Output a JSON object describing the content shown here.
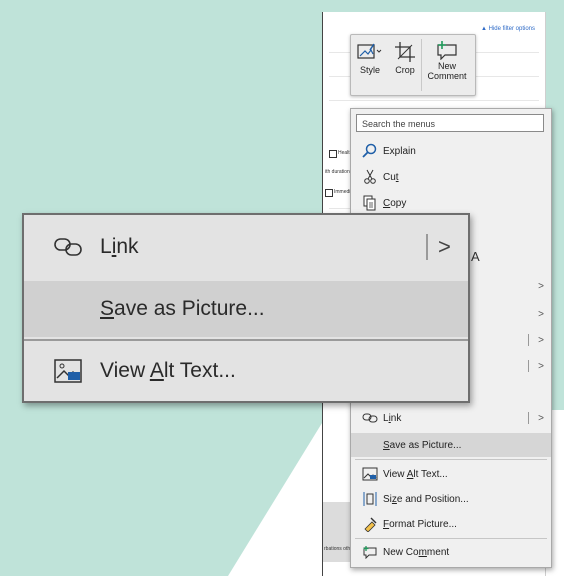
{
  "document": {
    "hide_filter_options": "▲ Hide filter options",
    "fragments": [
      "Health",
      "ith duration o",
      "Immedia",
      "rbations otherw"
    ]
  },
  "picture_toolbar": {
    "style_label": "Style",
    "crop_label": "Crop",
    "new_comment_line1": "New",
    "new_comment_line2": "Comment"
  },
  "context_menu": {
    "search_placeholder": "Search the menus",
    "explain": "Explain",
    "cut": {
      "pre": "Cu",
      "acc": "t",
      "post": ""
    },
    "copy": {
      "pre": "",
      "acc": "C",
      "post": "opy"
    },
    "link": {
      "pre": "L",
      "acc": "i",
      "post": "nk"
    },
    "save_as_picture": {
      "pre": "",
      "acc": "S",
      "post": "ave as Picture..."
    },
    "view_alt_text": {
      "pre": "View ",
      "acc": "A",
      "post": "lt Text..."
    },
    "size_and_position": {
      "pre": "Si",
      "acc": "z",
      "post": "e and Position..."
    },
    "format_picture": {
      "pre": "",
      "acc": "F",
      "post": "ormat Picture..."
    },
    "new_comment": {
      "pre": "New Co",
      "acc": "m",
      "post": "ment"
    },
    "submenu_arrow": ">",
    "pa_glyph": "A"
  },
  "zoomed_menu": {
    "link": {
      "pre": "L",
      "acc": "i",
      "post": "nk"
    },
    "save_as_picture": {
      "pre": "",
      "acc": "S",
      "post": "ave as Picture..."
    },
    "view_alt_text": {
      "pre": "View ",
      "acc": "A",
      "post": "lt Text..."
    },
    "submenu_arrow": ">"
  },
  "colors": {
    "background_mint": "#bfe3d9",
    "menu_bg": "#f0f0f0",
    "highlight": "#d6d6d6",
    "icon_blue": "#1f5fa8"
  }
}
